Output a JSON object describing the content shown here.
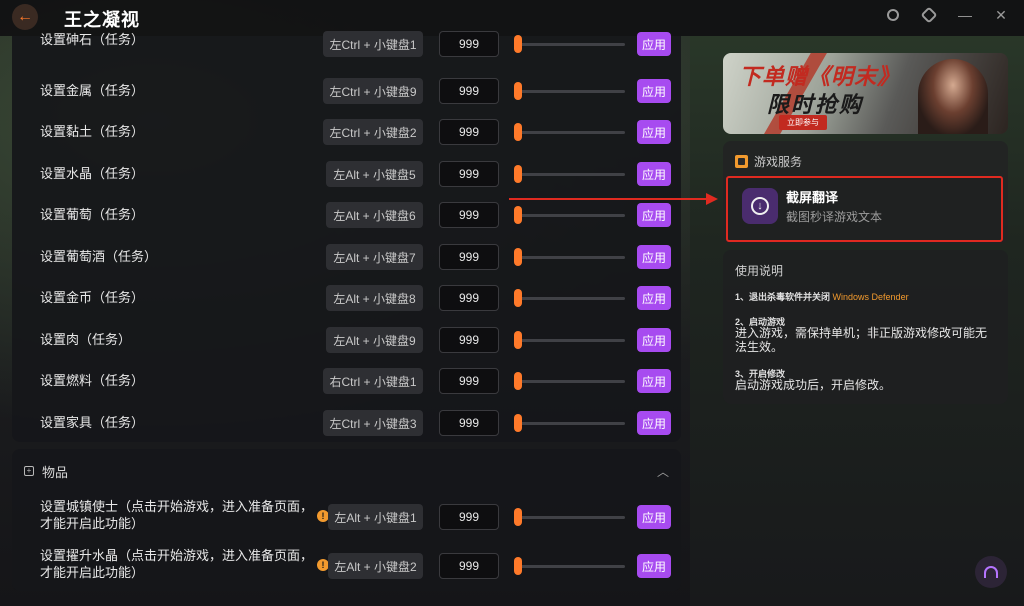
{
  "app": {
    "title": "王之凝视"
  },
  "tasks_panel": {
    "rows": [
      {
        "label": "设置砷石（任务）",
        "hotkey": "左Ctrl + 小键盘1",
        "value": "999",
        "apply": "应用"
      },
      {
        "label": "设置金属（任务）",
        "hotkey": "左Ctrl + 小键盘9",
        "value": "999",
        "apply": "应用"
      },
      {
        "label": "设置黏土（任务）",
        "hotkey": "左Ctrl + 小键盘2",
        "value": "999",
        "apply": "应用"
      },
      {
        "label": "设置水晶（任务）",
        "hotkey": "左Alt + 小键盘5",
        "value": "999",
        "apply": "应用"
      },
      {
        "label": "设置葡萄（任务）",
        "hotkey": "左Alt + 小键盘6",
        "value": "999",
        "apply": "应用"
      },
      {
        "label": "设置葡萄酒（任务）",
        "hotkey": "左Alt + 小键盘7",
        "value": "999",
        "apply": "应用"
      },
      {
        "label": "设置金币（任务）",
        "hotkey": "左Alt + 小键盘8",
        "value": "999",
        "apply": "应用"
      },
      {
        "label": "设置肉（任务）",
        "hotkey": "左Alt + 小键盘9",
        "value": "999",
        "apply": "应用"
      },
      {
        "label": "设置燃料（任务）",
        "hotkey": "右Ctrl + 小键盘1",
        "value": "999",
        "apply": "应用"
      },
      {
        "label": "设置家具（任务）",
        "hotkey": "左Ctrl + 小键盘3",
        "value": "999",
        "apply": "应用"
      }
    ]
  },
  "items_panel": {
    "title": "物品",
    "rows": [
      {
        "label_line1": "设置城镇使士（点击开始游戏，进入准备页面，",
        "label_line2": "才能开启此功能）",
        "info": "!",
        "hotkey": "左Alt + 小键盘1",
        "value": "999",
        "apply": "应用"
      },
      {
        "label_line1": "设置擢升水晶（点击开始游戏，进入准备页面，",
        "label_line2": "才能开启此功能）",
        "info": "!",
        "hotkey": "左Alt + 小键盘2",
        "value": "999",
        "apply": "应用"
      }
    ]
  },
  "banner": {
    "line1": "下单赠《明末》",
    "line2": "限时抢购",
    "tag": "立即参与"
  },
  "game_service": {
    "title": "游戏服务",
    "card": {
      "name": "截屏翻译",
      "desc": "截图秒译游戏文本"
    }
  },
  "howto": {
    "title": "使用说明",
    "step1": "1、退出杀毒软件并关闭",
    "step1_accent": "Windows Defender",
    "step2": "2、启动游戏",
    "step2_body": "进入游戏，需保持单机；非正版游戏修改可能无法生效。",
    "step3": "3、开启修改",
    "step3_body": "启动游戏成功后，开启修改。"
  },
  "colors": {
    "accent_orange": "#ff7a2a",
    "apply_purple": "#a74bf0",
    "highlight_red": "#e02a20"
  }
}
